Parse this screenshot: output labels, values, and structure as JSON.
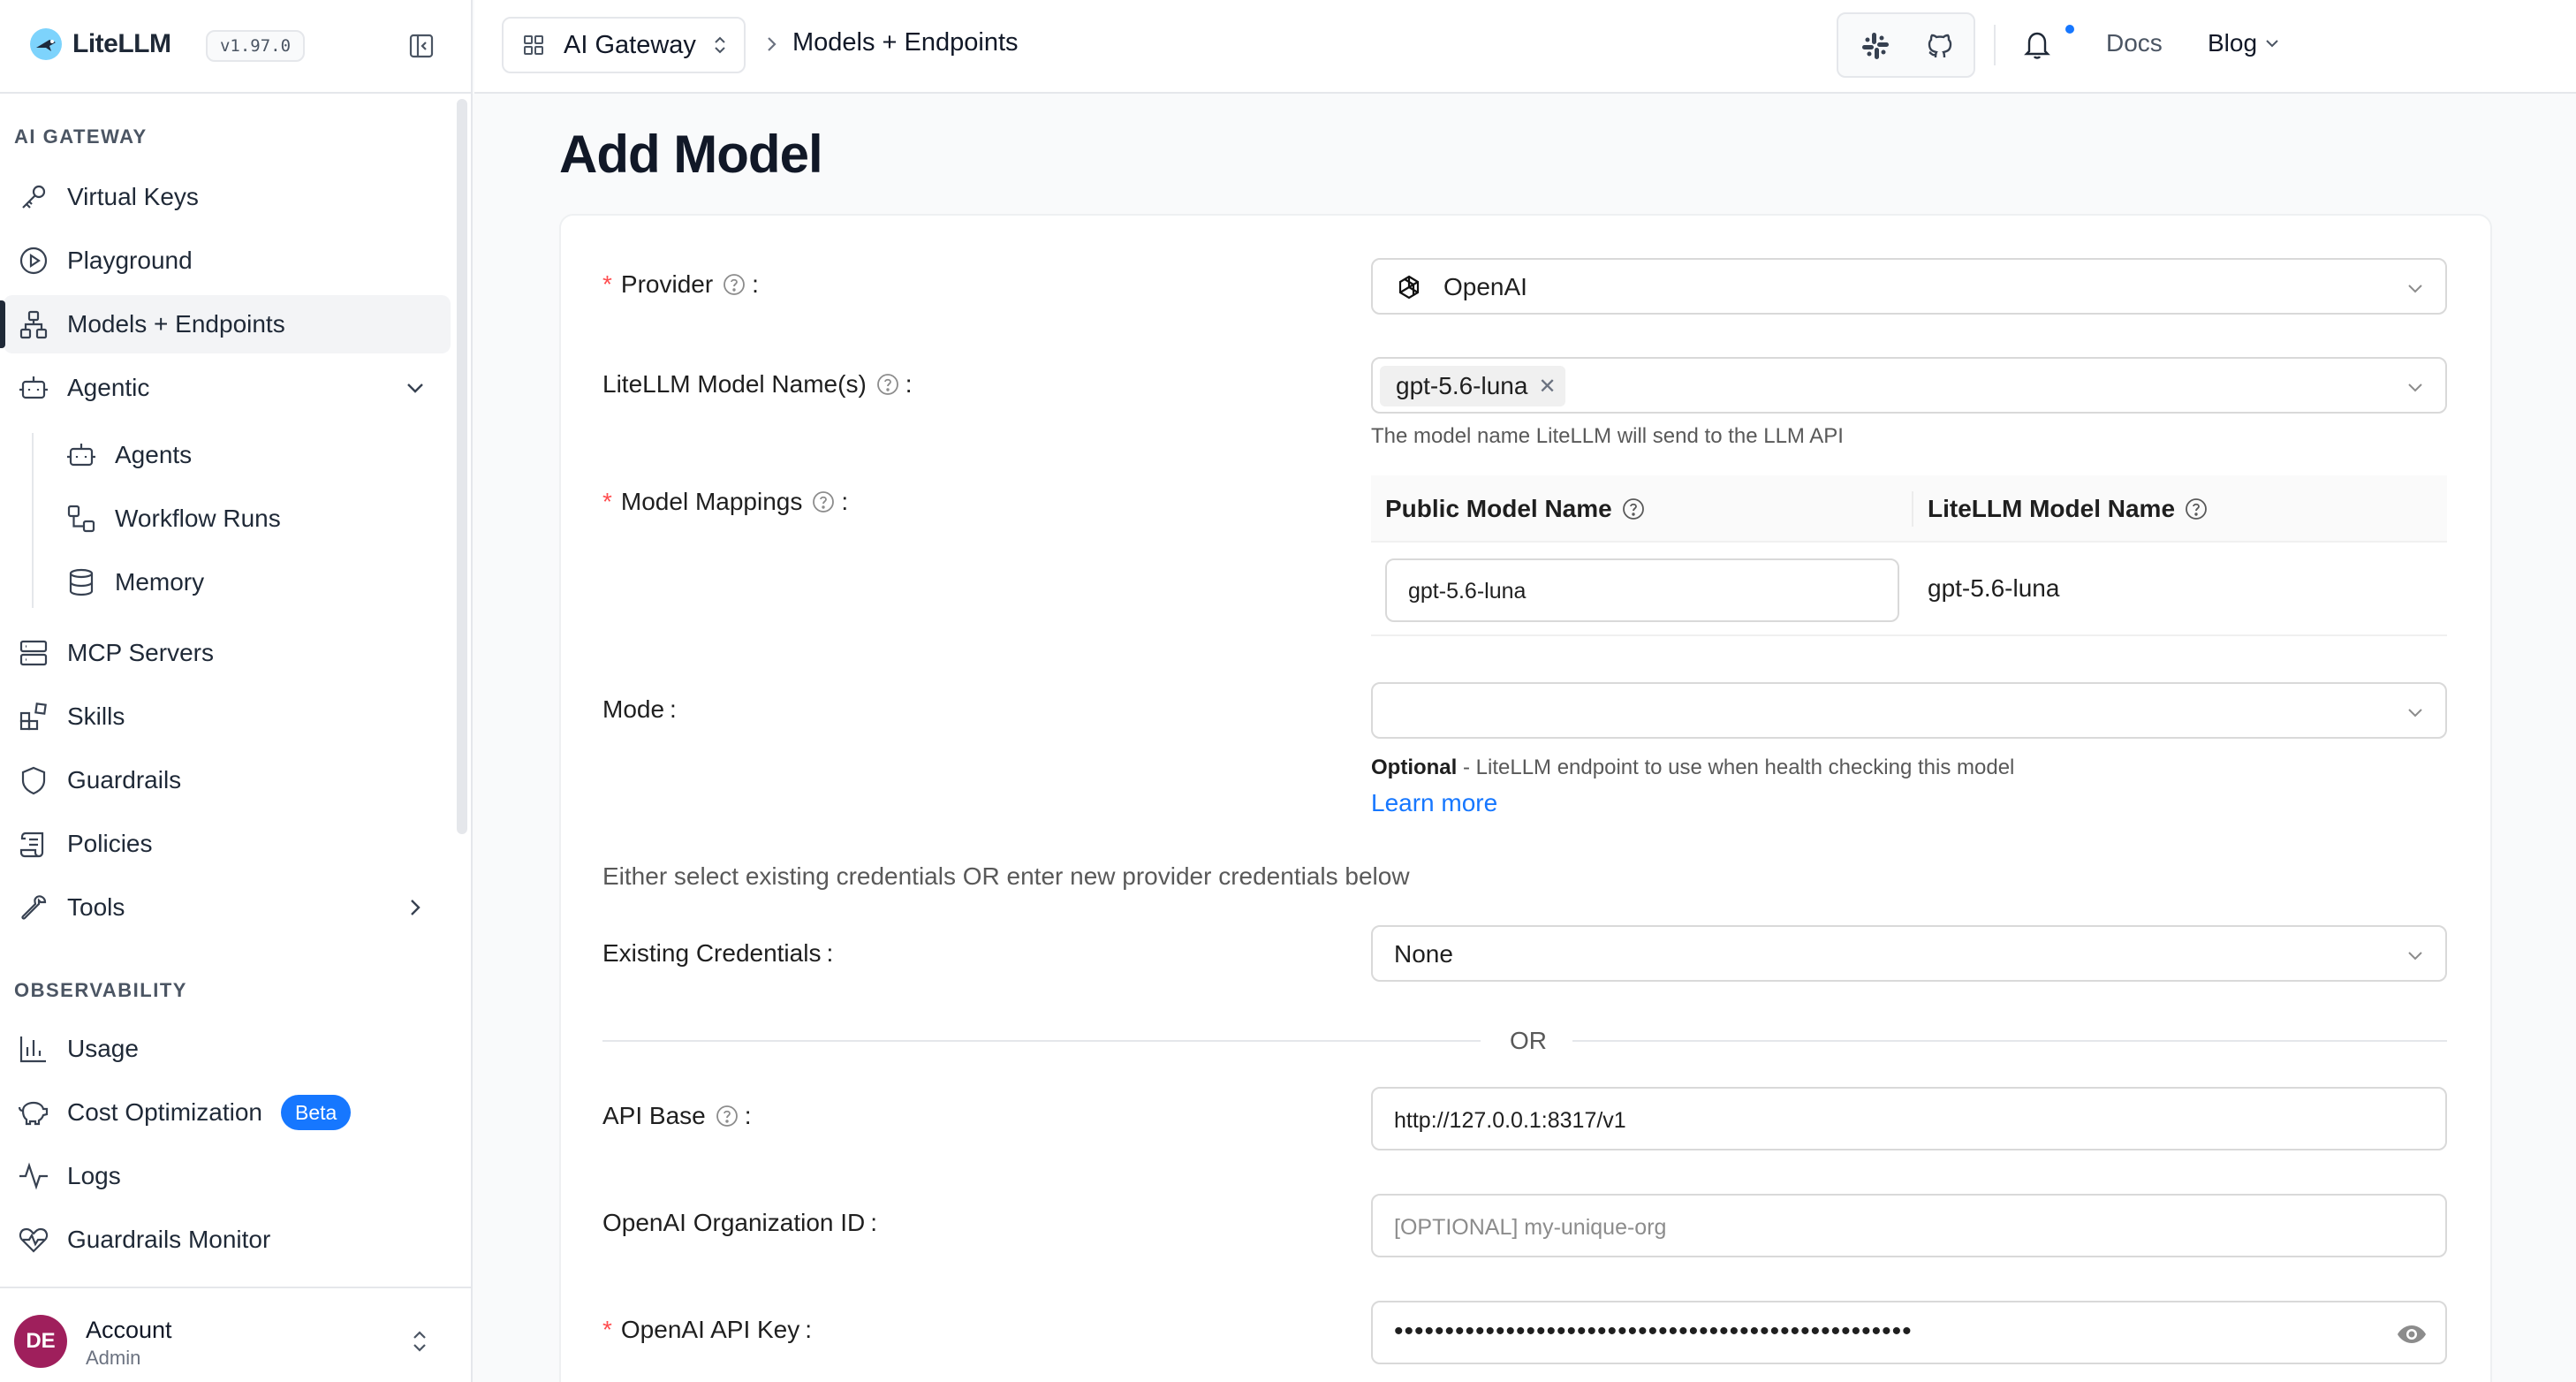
{
  "app": {
    "name": "LiteLLM",
    "version": "v1.97.0"
  },
  "sidebar": {
    "sections": [
      {
        "label": "AI GATEWAY"
      },
      {
        "label": "OBSERVABILITY"
      }
    ],
    "items": [
      {
        "label": "Virtual Keys",
        "icon": "key-icon"
      },
      {
        "label": "Playground",
        "icon": "play-circle-icon"
      },
      {
        "label": "Models + Endpoints",
        "icon": "network-icon",
        "active": true
      },
      {
        "label": "Agentic",
        "icon": "robot-icon",
        "expanded": true
      },
      {
        "label": "Agents",
        "icon": "robot-icon"
      },
      {
        "label": "Workflow Runs",
        "icon": "workflow-icon"
      },
      {
        "label": "Memory",
        "icon": "database-icon"
      },
      {
        "label": "MCP Servers",
        "icon": "server-icon"
      },
      {
        "label": "Skills",
        "icon": "blocks-icon"
      },
      {
        "label": "Guardrails",
        "icon": "shield-icon"
      },
      {
        "label": "Policies",
        "icon": "scroll-icon"
      },
      {
        "label": "Tools",
        "icon": "wrench-icon"
      },
      {
        "label": "Usage",
        "icon": "bar-chart-icon"
      },
      {
        "label": "Cost Optimization",
        "icon": "piggy-bank-icon",
        "badge": "Beta"
      },
      {
        "label": "Logs",
        "icon": "activity-icon"
      },
      {
        "label": "Guardrails Monitor",
        "icon": "heart-pulse-icon"
      }
    ],
    "account": {
      "initials": "DE",
      "name": "Account",
      "role": "Admin"
    }
  },
  "topbar": {
    "gateway": "AI Gateway",
    "breadcrumb": "Models + Endpoints",
    "docs": "Docs",
    "blog": "Blog"
  },
  "form": {
    "title": "Add Model",
    "provider": {
      "label": "Provider",
      "value": "OpenAI"
    },
    "model_names": {
      "label": "LiteLLM Model Name(s)",
      "tag": "gpt-5.6-luna",
      "help": "The model name LiteLLM will send to the LLM API"
    },
    "mappings": {
      "label": "Model Mappings",
      "col_public": "Public Model Name",
      "col_litellm": "LiteLLM Model Name",
      "public_value": "gpt-5.6-luna",
      "litellm_value": "gpt-5.6-luna"
    },
    "mode": {
      "label": "Mode",
      "help_bold": "Optional",
      "help": " - LiteLLM endpoint to use when health checking this model",
      "link": "Learn more"
    },
    "credentials_note": "Either select existing credentials OR enter new provider credentials below",
    "existing_credentials": {
      "label": "Existing Credentials",
      "value": "None"
    },
    "or": "OR",
    "api_base": {
      "label": "API Base",
      "value": "http://127.0.0.1:8317/v1"
    },
    "org_id": {
      "label": "OpenAI Organization ID",
      "placeholder": "[OPTIONAL] my-unique-org"
    },
    "api_key": {
      "label": "OpenAI API Key",
      "masked": "•••••••••••••••••••••••••••••••••••••••••••••••••••"
    }
  },
  "colors": {
    "accent": "#1677ff",
    "required": "#ff4d4f",
    "avatar": "#9f1f5c"
  }
}
